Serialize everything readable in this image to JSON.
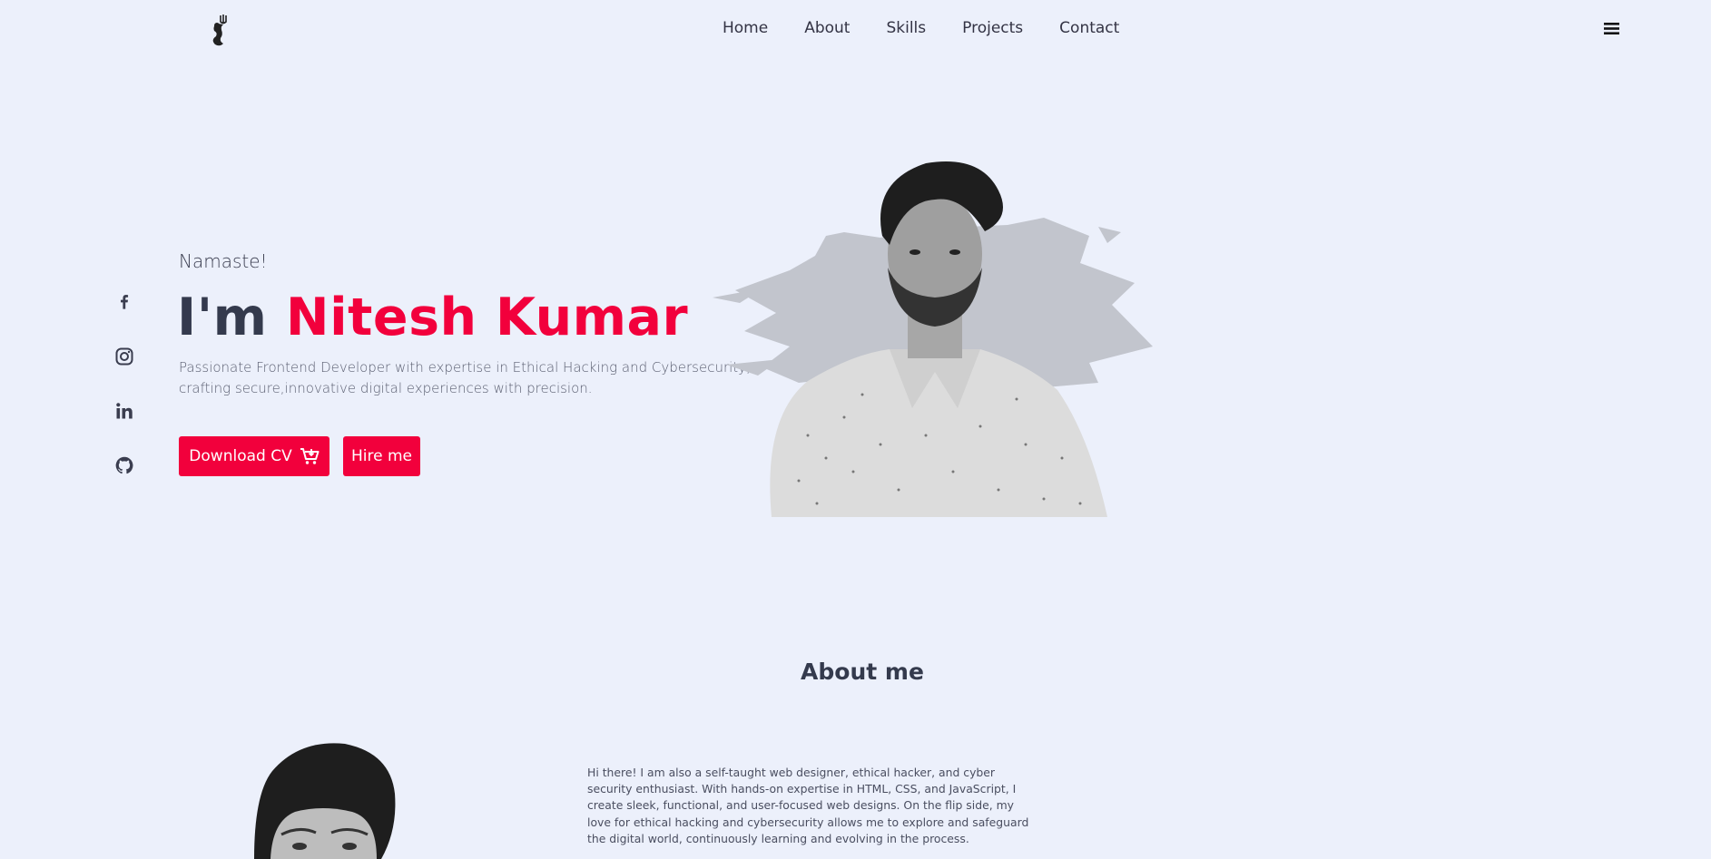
{
  "nav": {
    "links": [
      "Home",
      "About",
      "Skills",
      "Projects",
      "Contact"
    ],
    "logo_icon": "trident-figure-logo",
    "menu_icon": "hamburger-menu-icon"
  },
  "socials": {
    "icons": [
      "facebook-icon",
      "instagram-icon",
      "linkedin-icon",
      "github-icon"
    ]
  },
  "hero": {
    "greeting": "Namaste!",
    "headline_prefix": "I'm",
    "headline_name": "Nitesh Kumar",
    "description": "Passionate Frontend Developer with expertise in Ethical Hacking and Cybersecurity, crafting secure,innovative digital experiences with precision.",
    "download_cv_label": "Download CV",
    "download_cv_icon": "cart-icon",
    "hire_label": "Hire me"
  },
  "about": {
    "title": "About me",
    "text": "Hi there! I am also a self-taught web designer, ethical hacker, and cyber security enthusiast. With hands-on expertise in HTML, CSS, and JavaScript, I create sleek, functional, and user-focused web designs. On the flip side, my love for ethical hacking and cybersecurity allows me to explore and safeguard the digital world, continuously learning and evolving in the process."
  },
  "colors": {
    "background": "#ecf0fb",
    "accent": "#f2003c",
    "heading": "#343a4d"
  }
}
